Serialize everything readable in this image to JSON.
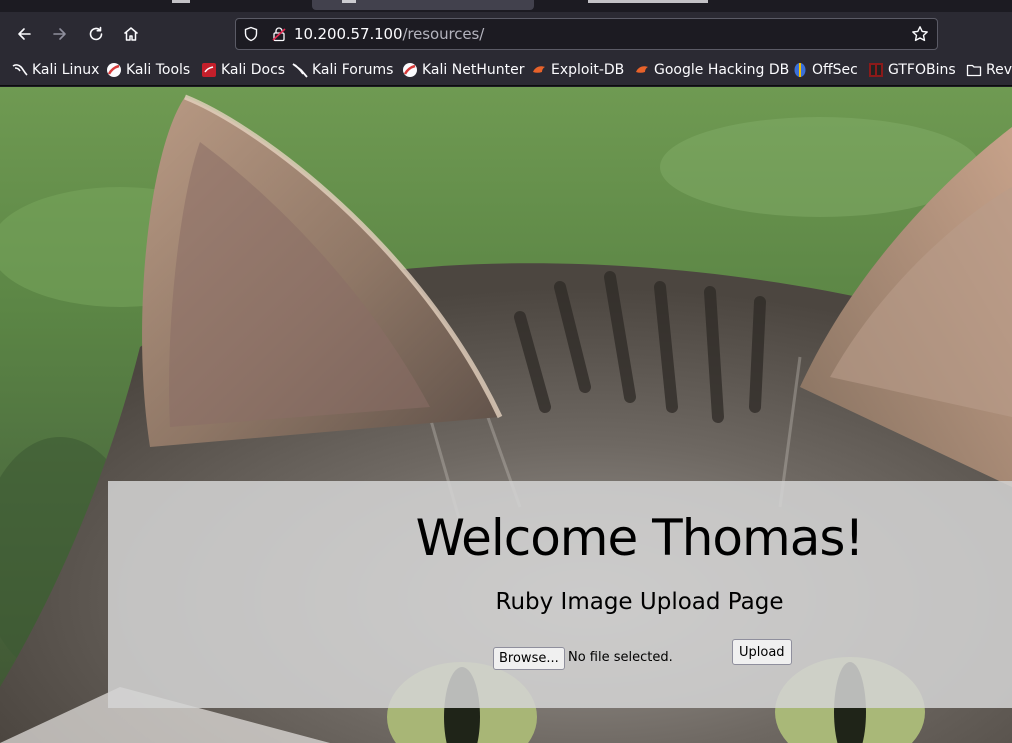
{
  "browser": {
    "url_host": "10.200.57.100",
    "url_path": "/resources/",
    "bookmarks": [
      {
        "label": "Kali Linux",
        "icon": "kali-dragon-icon"
      },
      {
        "label": "Kali Tools",
        "icon": "kali-tools-icon"
      },
      {
        "label": "Kali Docs",
        "icon": "kali-docs-icon"
      },
      {
        "label": "Kali Forums",
        "icon": "kali-forums-icon"
      },
      {
        "label": "Kali NetHunter",
        "icon": "kali-nethunter-icon"
      },
      {
        "label": "Exploit-DB",
        "icon": "exploit-db-icon"
      },
      {
        "label": "Google Hacking DB",
        "icon": "ghdb-icon"
      },
      {
        "label": "OffSec",
        "icon": "offsec-icon"
      },
      {
        "label": "GTFOBins",
        "icon": "gtfobins-icon"
      },
      {
        "label": "RevS",
        "icon": "folder-icon"
      }
    ]
  },
  "page": {
    "heading": "Welcome Thomas!",
    "subtitle": "Ruby Image Upload Page",
    "browse_label": "Browse...",
    "file_status": "No file selected.",
    "upload_label": "Upload"
  },
  "colors": {
    "chrome_bg": "#2b2a33",
    "tab_bg": "#1c1b22",
    "text": "#fbfbfe",
    "panel": "#d4d4d4"
  }
}
